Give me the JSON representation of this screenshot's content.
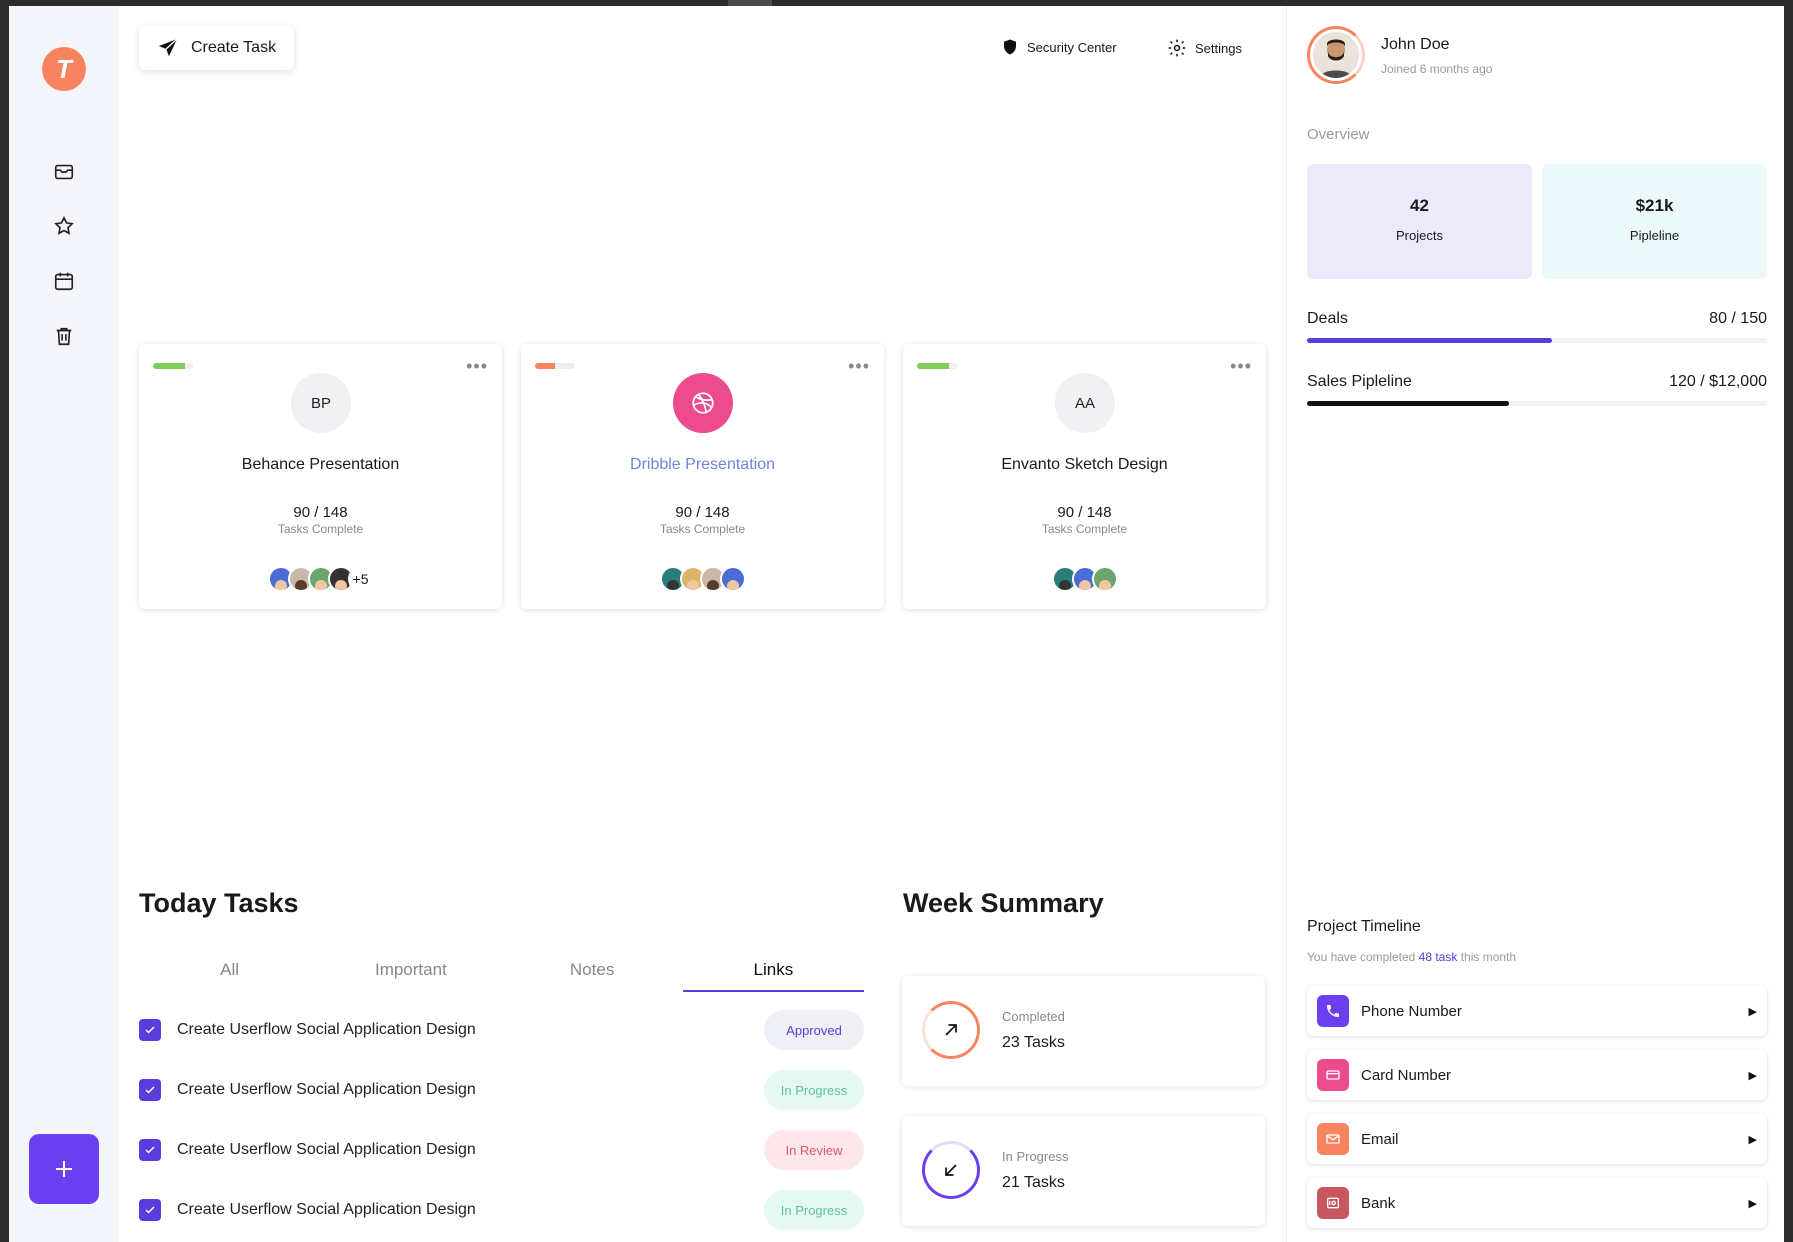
{
  "sidebar": {
    "logo_letter": "T",
    "items": [
      {
        "icon": "inbox-icon"
      },
      {
        "icon": "star-icon"
      },
      {
        "icon": "calendar-icon"
      },
      {
        "icon": "trash-icon"
      }
    ]
  },
  "header": {
    "create_label": "Create Task",
    "security_label": "Security Center",
    "settings_label": "Settings"
  },
  "projects": [
    {
      "initials": "BP",
      "name": "Behance Presentation",
      "count": "90 / 148",
      "label": "Tasks Complete",
      "bar_color": "#7fce5c",
      "bar_fill": 0.8,
      "extra": "+5"
    },
    {
      "initials": "",
      "name": "Dribble Presentation",
      "count": "90 / 148",
      "label": "Tasks Complete",
      "bar_color": "#f7845e",
      "bar_fill": 0.5
    },
    {
      "initials": "AA",
      "name": "Envanto Sketch Design",
      "count": "90 / 148",
      "label": "Tasks Complete",
      "bar_color": "#7fce5c",
      "bar_fill": 0.8
    }
  ],
  "today": {
    "title": "Today Tasks",
    "tabs": [
      "All",
      "Important",
      "Notes",
      "Links"
    ],
    "active_tab": "Links",
    "tasks": [
      {
        "text": "Create Userflow Social Application Design",
        "status": "Approved"
      },
      {
        "text": "Create Userflow Social Application Design",
        "status": "In Progress"
      },
      {
        "text": "Create Userflow Social Application Design",
        "status": "In Review"
      },
      {
        "text": "Create Userflow Social Application Design",
        "status": "In Progress"
      }
    ]
  },
  "week": {
    "title": "Week Summary",
    "items": [
      {
        "label": "Completed",
        "value": "23 Tasks"
      },
      {
        "label": "In Progress",
        "value": "21 Tasks"
      }
    ]
  },
  "profile": {
    "name": "John Doe",
    "joined": "Joined 6 months ago"
  },
  "overview": {
    "label": "Overview",
    "stats": [
      {
        "value": "42",
        "label": "Projects"
      },
      {
        "value": "$21k",
        "label": "Pipleline"
      }
    ],
    "progress": [
      {
        "label": "Deals",
        "value": "80 / 150",
        "fraction": 0.533
      },
      {
        "label": "Sales Pipleline",
        "value": "120 / $12,000",
        "fraction": 0.44
      }
    ]
  },
  "timeline": {
    "title": "Project Timeline",
    "sub_prefix": "You have completed",
    "sub_highlight": "48 task",
    "sub_suffix": "this month",
    "items": [
      {
        "label": "Phone Number",
        "icon": "phone-icon"
      },
      {
        "label": "Card Number",
        "icon": "card-icon"
      },
      {
        "label": "Email",
        "icon": "mail-icon"
      },
      {
        "label": "Bank",
        "icon": "bank-icon"
      }
    ]
  },
  "colors": {
    "accent": "#5a3bdb",
    "orange": "#f7845e",
    "pink": "#ec4b8d",
    "green": "#7fce5c"
  }
}
